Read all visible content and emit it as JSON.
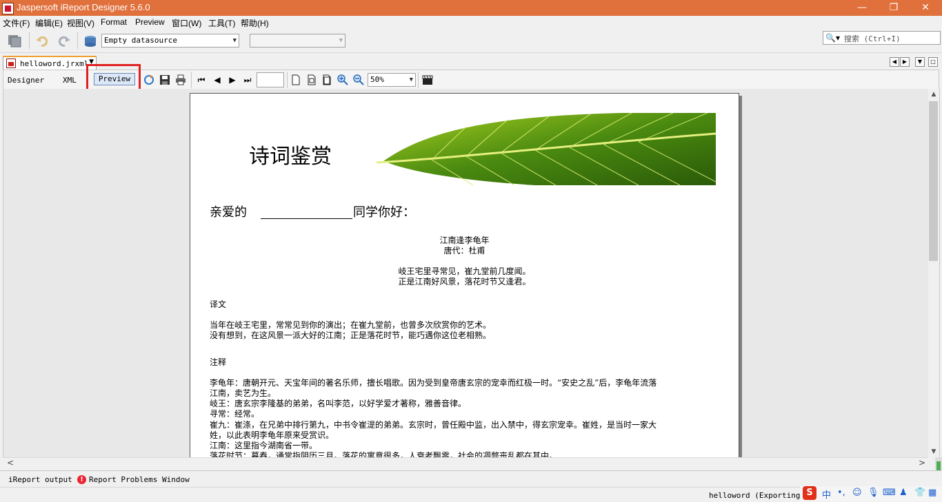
{
  "window": {
    "title": "Jaspersoft iReport Designer 5.6.0",
    "minimize": "—",
    "maximize": "❐",
    "close": "✕"
  },
  "menu": [
    "文件(F)",
    "编辑(E)",
    "视图(V)",
    "Format",
    "Preview",
    "窗口(W)",
    "工具(T)",
    "帮助(H)"
  ],
  "toolbar": {
    "datasource": "Empty datasource",
    "second_select": ""
  },
  "search": {
    "placeholder": "搜索 (Ctrl+I)"
  },
  "document_tab": {
    "label": "helloword.jrxml"
  },
  "modes": {
    "designer": "Designer",
    "xml": "XML",
    "preview": "Preview"
  },
  "preview_toolbar": {
    "page_value": "",
    "zoom": "50%"
  },
  "report": {
    "title": "诗词鉴赏",
    "greeting_left": "亲爱的",
    "greeting_right": "同学你好：",
    "poem_title": "江南逢李龟年",
    "poem_author": "唐代：杜甫",
    "poem_line1": "岐王宅里寻常见，崔九堂前几度闻。",
    "poem_line2": "正是江南好风景，落花时节又逢君。",
    "translation_heading": "译文",
    "translation_line1": "当年在岐王宅里，常常见到你的演出；在崔九堂前，也曾多次欣赏你的艺术。",
    "translation_line2": "没有想到，在这风景一派大好的江南；正是落花时节，能巧遇你这位老相熟。",
    "notes_heading": "注释",
    "notes": [
      "李龟年：唐朝开元、天宝年间的著名乐师，擅长唱歌。因为受到皇帝唐玄宗的宠幸而红极一时。“安史之乱”后，李龟年流落",
      "江南，卖艺为生。",
      "岐王：唐玄宗李隆基的弟弟，名叫李范，以好学爱才著称，雅善音律。",
      "寻常：经常。",
      "崔九：崔涤，在兄弟中排行第九，中书令崔湜的弟弟。玄宗时，曾任殿中监，出入禁中，得玄宗宠幸。崔姓，是当时一家大",
      "姓，以此表明李龟年原来受赏识。",
      "江南：这里指今湖南省一带。",
      "落花时节：暮春，通常指阴历三月。落花的寓意很多，人衰老飘零，社会的凋弊丧乱都在其中。"
    ]
  },
  "bottom_tabs": {
    "output": "iReport output",
    "problems": "Report Problems Window"
  },
  "status": {
    "text": "helloword (Exporting re"
  },
  "ime": {
    "logo": "S",
    "lang": "中",
    "punct": "•,"
  },
  "icons": {
    "save": "save-icon",
    "undo": "undo-icon",
    "redo": "redo-icon",
    "datasource": "datasource-icon",
    "search": "search-icon",
    "refresh": "refresh-icon",
    "print": "print-icon",
    "first": "first-page-icon",
    "prev": "prev-page-icon",
    "next": "next-page-icon",
    "last": "last-page-icon",
    "zoom_in": "zoom-in-icon",
    "zoom_out": "zoom-out-icon",
    "clapper": "clapperboard-icon"
  }
}
